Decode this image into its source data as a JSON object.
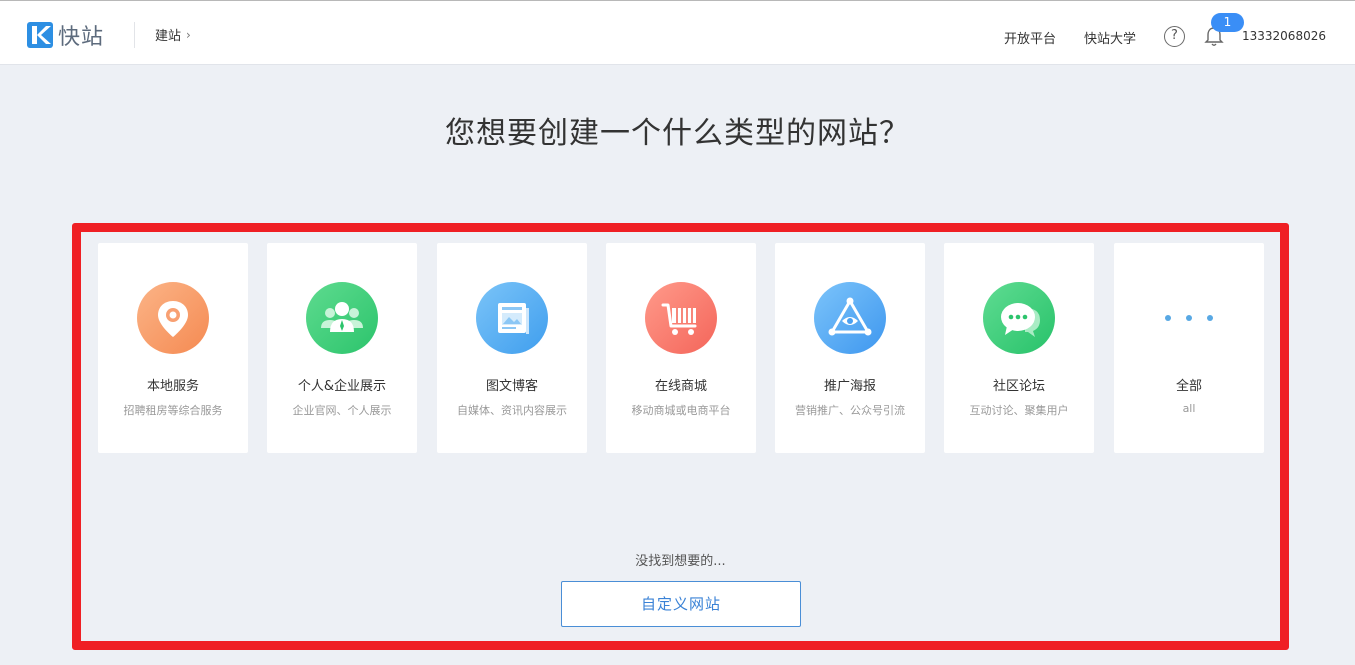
{
  "header": {
    "logo_text": "快站",
    "breadcrumb": "建站",
    "nav": {
      "open_platform": "开放平台",
      "university": "快站大学"
    },
    "help_glyph": "?",
    "notification_count": "1",
    "user_phone": "13332068026"
  },
  "main": {
    "title": "您想要创建一个什么类型的网站？",
    "cards": [
      {
        "title": "本地服务",
        "subtitle": "招聘租房等综合服务",
        "icon": "location-pin-icon",
        "color_from": "#fbb487",
        "color_to": "#f58a52"
      },
      {
        "title": "个人&企业展示",
        "subtitle": "企业官网、个人展示",
        "icon": "people-icon",
        "color_from": "#5edb8f",
        "color_to": "#2cc46c"
      },
      {
        "title": "图文博客",
        "subtitle": "自媒体、资讯内容展示",
        "icon": "article-icon",
        "color_from": "#7bc4f8",
        "color_to": "#3f9eee"
      },
      {
        "title": "在线商城",
        "subtitle": "移动商城或电商平台",
        "icon": "shopping-cart-icon",
        "color_from": "#ff9a8a",
        "color_to": "#f4655a"
      },
      {
        "title": "推广海报",
        "subtitle": "营销推广、公众号引流",
        "icon": "triangle-eye-icon",
        "color_from": "#7cc4fa",
        "color_to": "#3e97ef"
      },
      {
        "title": "社区论坛",
        "subtitle": "互动讨论、聚集用户",
        "icon": "chat-bubble-icon",
        "color_from": "#5fdc92",
        "color_to": "#28c26a"
      },
      {
        "title": "全部",
        "subtitle": "all",
        "icon": "more-dots-icon",
        "color_from": "#58a8e4",
        "color_to": "#58a8e4"
      }
    ],
    "not_found_text": "没找到想要的...",
    "custom_button_label": "自定义网站"
  },
  "colors": {
    "accent": "#3a8ef6",
    "highlight_border": "#ef1f24",
    "page_bg": "#edf0f5"
  }
}
